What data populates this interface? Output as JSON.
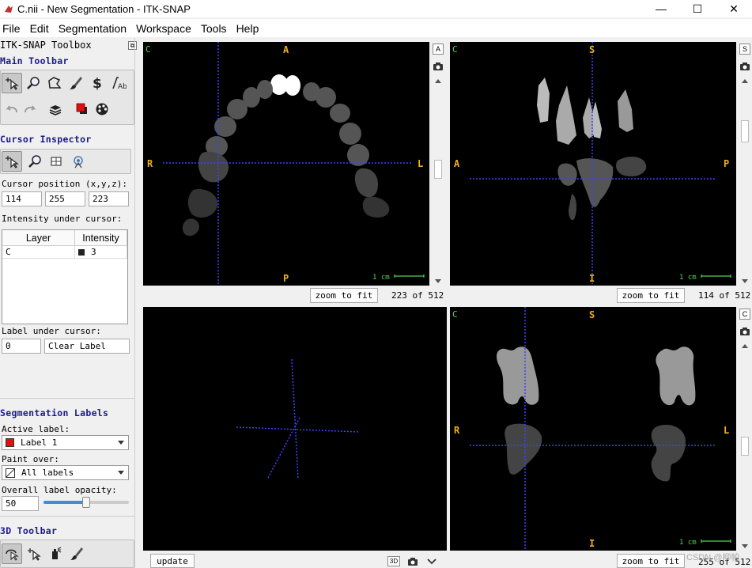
{
  "window": {
    "title": "C.nii - New Segmentation - ITK-SNAP",
    "minimize": "—",
    "maximize": "☐",
    "close": "✕"
  },
  "menu": [
    "File",
    "Edit",
    "Segmentation",
    "Workspace",
    "Tools",
    "Help"
  ],
  "toolbox": {
    "title": "ITK-SNAP Toolbox",
    "main_toolbar_title": "Main Toolbar",
    "cursor_inspector_title": "Cursor Inspector",
    "cursor_position_label": "Cursor position (x,y,z):",
    "cursor_x": "114",
    "cursor_y": "255",
    "cursor_z": "223",
    "intensity_label": "Intensity under cursor:",
    "layer_col": "Layer",
    "intensity_col": "Intensity",
    "layer_rows": [
      {
        "layer": "C",
        "intensity": "3"
      }
    ],
    "label_under_cursor": "Label under cursor:",
    "label_value": "0",
    "label_name": "Clear Label",
    "seg_labels_title": "Segmentation Labels",
    "active_label_lbl": "Active label:",
    "active_label": "Label 1",
    "active_label_color": "#e01010",
    "paint_over_lbl": "Paint over:",
    "paint_over": "All labels",
    "opacity_lbl": "Overall label opacity:",
    "opacity_value": "50",
    "opacity_fraction": 0.5,
    "toolbar_3d_title": "3D Toolbar"
  },
  "views": {
    "axial": {
      "corner": "C",
      "top": "A",
      "bottom": "P",
      "left": "R",
      "right": "L",
      "scale": "1 cm",
      "zoom": "zoom to fit",
      "slice": "223 of 512"
    },
    "sagittal": {
      "corner": "C",
      "top": "S",
      "bottom": "I",
      "left": "A",
      "right": "P",
      "scale": "1 cm",
      "zoom": "zoom to fit",
      "slice": "114 of 512"
    },
    "coronal": {
      "corner": "C",
      "top": "S",
      "bottom": "I",
      "left": "R",
      "right": "L",
      "scale": "1 cm",
      "zoom": "zoom to fit",
      "slice": "255 of 512"
    },
    "three_d": {
      "update": "update"
    }
  },
  "side_buttons": {
    "axial": "A",
    "sagittal": "S",
    "coronal": "C",
    "three_d_btn": "3D"
  },
  "watermark": "CSDN @柳帕"
}
